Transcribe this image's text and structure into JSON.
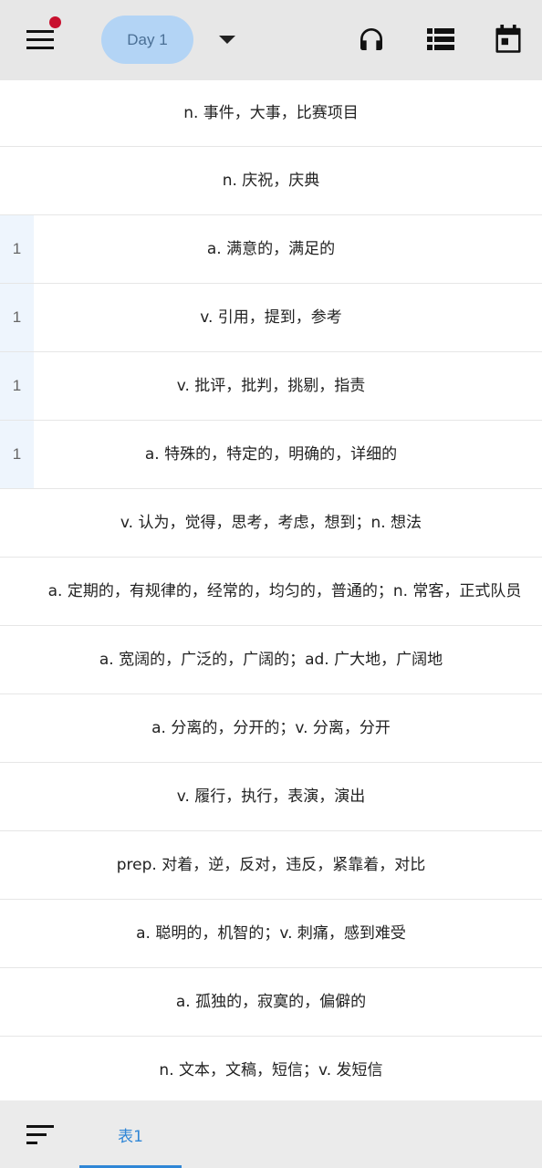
{
  "header": {
    "day_label": "Day 1",
    "icons": [
      "menu-icon",
      "caret-down-icon",
      "headphones-icon",
      "list-icon",
      "calendar-icon"
    ],
    "notification_color": "#c8102e"
  },
  "rows": [
    {
      "count": "",
      "text": "n. 事件，大事，比赛项目"
    },
    {
      "count": "",
      "text": "n. 庆祝，庆典"
    },
    {
      "count": "1",
      "text": "a. 满意的，满足的"
    },
    {
      "count": "1",
      "text": "v. 引用，提到，参考"
    },
    {
      "count": "1",
      "text": "v. 批评，批判，挑剔，指责"
    },
    {
      "count": "1",
      "text": "a. 特殊的，特定的，明确的，详细的"
    },
    {
      "count": "",
      "text": "v. 认为，觉得，思考，考虑，想到；n. 想法"
    },
    {
      "count": "",
      "text": "a. 定期的，有规律的，经常的，均匀的，普通的；n. 常客，正式队员"
    },
    {
      "count": "",
      "text": "a. 宽阔的，广泛的，广阔的；ad. 广大地，广阔地"
    },
    {
      "count": "",
      "text": "a. 分离的，分开的；v. 分离，分开"
    },
    {
      "count": "",
      "text": "v. 履行，执行，表演，演出"
    },
    {
      "count": "",
      "text": "prep. 对着，逆，反对，违反，紧靠着，对比"
    },
    {
      "count": "",
      "text": "a. 聪明的，机智的；v. 刺痛，感到难受"
    },
    {
      "count": "",
      "text": "a. 孤独的，寂寞的，偏僻的"
    },
    {
      "count": "",
      "text": "n. 文本，文稿，短信；v. 发短信"
    }
  ],
  "footer": {
    "tab_label": "表1",
    "accent_color": "#2f86d6"
  }
}
